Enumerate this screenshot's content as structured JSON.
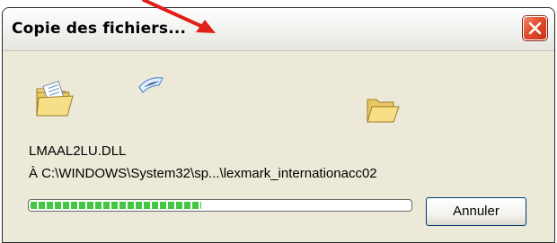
{
  "window": {
    "title": "Copie des fichiers..."
  },
  "content": {
    "filename": "LMAAL2LU.DLL",
    "destination_path": "À C:\\WINDOWS\\System32\\sp...\\lexmark_internationacc02"
  },
  "progress": {
    "fraction": 0.45,
    "color": "#43c740"
  },
  "buttons": {
    "cancel_label": "Annuler"
  },
  "icons": {
    "source_folder": "folder-with-document-icon",
    "flying_document": "flying-document-icon",
    "destination_folder": "open-folder-icon",
    "close": "close-icon"
  },
  "annotation": {
    "arrow_color": "#e0201a"
  }
}
